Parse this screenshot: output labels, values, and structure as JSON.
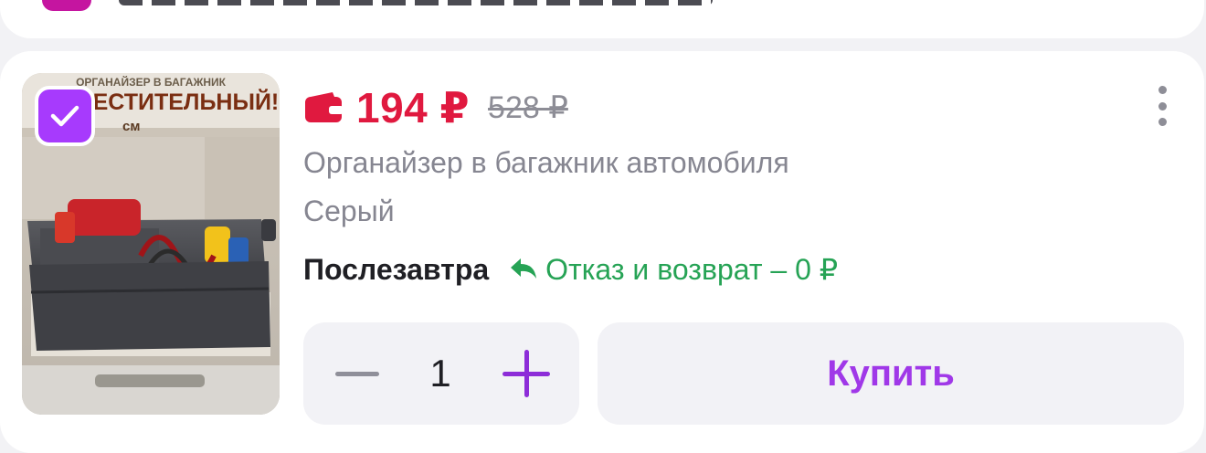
{
  "product": {
    "image_alt": "Органайзер в багажник",
    "image_banner_top": "ОРГАНАЙЗЕР В БАГАЖНИК",
    "image_banner_mid": "ВМЕСТИТЕЛЬНЫЙ!",
    "image_banner_size": "см",
    "selected": true,
    "price_current": "194 ₽",
    "price_old": "528 ₽",
    "title": "Органайзер в багажник автомобиля",
    "color": "Серый",
    "delivery": "Послезавтра",
    "return_policy": "Отказ и возврат – 0 ₽",
    "quantity": "1",
    "buy_label": "Купить"
  },
  "icons": {
    "wallet": "wallet-icon",
    "return": "return-arrow-icon",
    "more": "more-vertical-icon",
    "check": "check-icon",
    "minus": "minus-icon",
    "plus": "plus-icon"
  },
  "colors": {
    "price": "#e0193f",
    "accent": "#a73afd",
    "return": "#26a355",
    "muted": "#868691"
  }
}
